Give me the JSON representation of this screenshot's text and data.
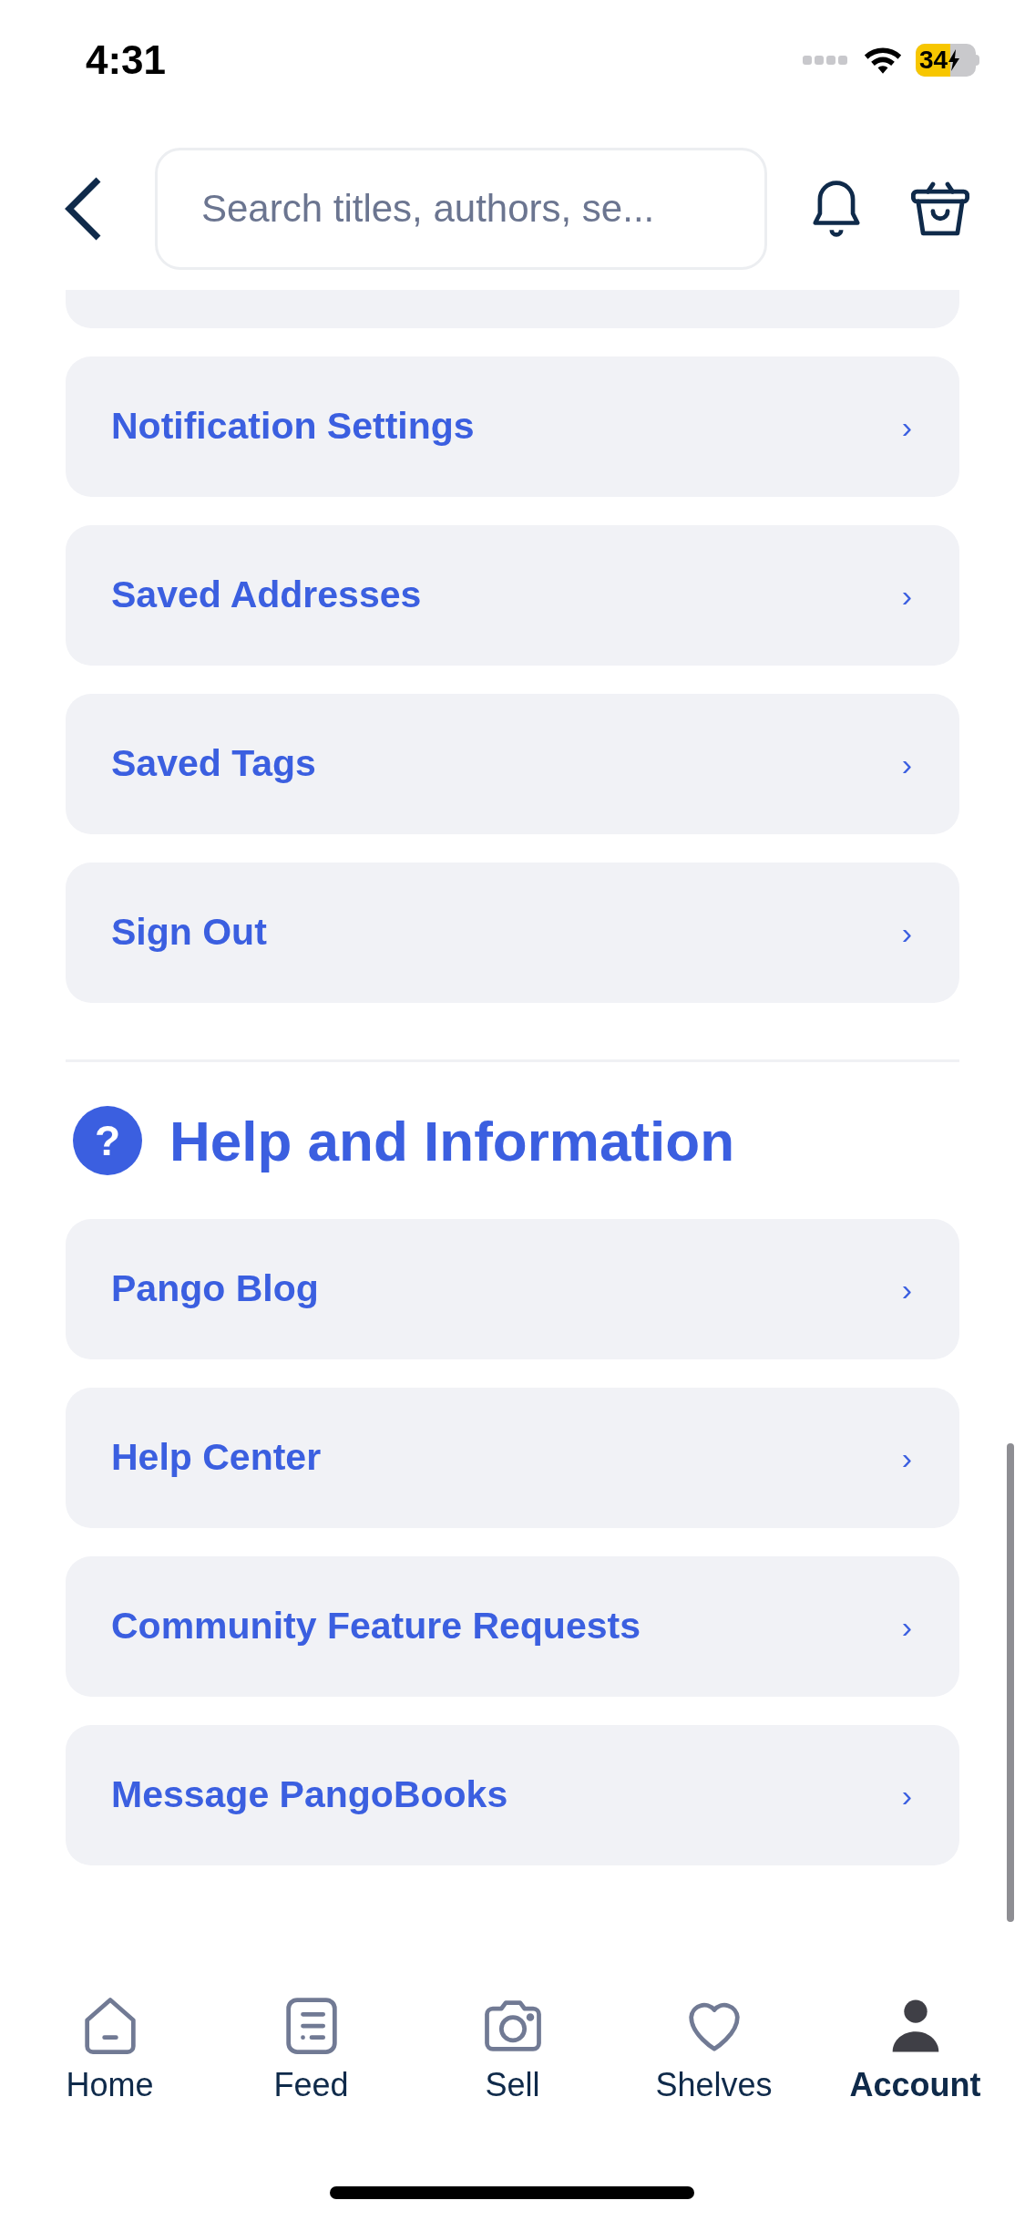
{
  "status_bar": {
    "time": "4:31",
    "battery": "34"
  },
  "header": {
    "search": {
      "placeholder": "Search titles, authors, se..."
    }
  },
  "account_items": [
    {
      "label": "Notification Settings"
    },
    {
      "label": "Saved Addresses"
    },
    {
      "label": "Saved Tags"
    },
    {
      "label": "Sign Out"
    }
  ],
  "help_section": {
    "title": "Help and Information",
    "icon": "?",
    "items": [
      {
        "label": "Pango Blog"
      },
      {
        "label": "Help Center"
      },
      {
        "label": "Community Feature Requests"
      },
      {
        "label": "Message PangoBooks"
      }
    ]
  },
  "chevron": "›",
  "tab_bar": [
    {
      "label": "Home",
      "selected": false
    },
    {
      "label": "Feed",
      "selected": false
    },
    {
      "label": "Sell",
      "selected": false
    },
    {
      "label": "Shelves",
      "selected": false
    },
    {
      "label": "Account",
      "selected": true
    }
  ]
}
